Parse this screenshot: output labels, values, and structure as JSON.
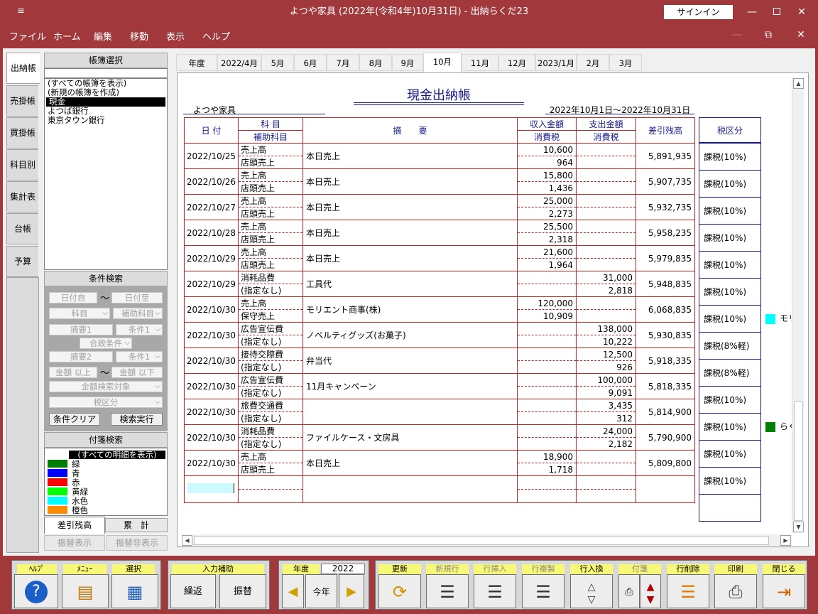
{
  "window": {
    "title": "よつや家具 (2022年(令和4年)10月31日)  -  出納らくだ23",
    "signin": "サインイン",
    "min": "—",
    "max": "☐",
    "close": "✕",
    "mdi_min": "—",
    "mdi_restore": "⧉",
    "mdi_close": "✕",
    "sysicon": "≡"
  },
  "menu": [
    "ファイル",
    "ホーム",
    "編集",
    "移動",
    "表示",
    "ヘルプ"
  ],
  "vtabs": [
    "出納帳",
    "売掛帳",
    "買掛帳",
    "科目別",
    "集計表",
    "台帳",
    "予算"
  ],
  "ledger": {
    "header": "帳簿選択",
    "items": [
      "(すべての帳簿を表示)",
      "(新規の帳簿を作成)",
      "現金",
      "よつば銀行",
      "東京タウン銀行"
    ],
    "selected": 2
  },
  "cond": {
    "header": "条件検索",
    "date_from": "日付自",
    "tilde": "〜",
    "date_to": "日付至",
    "account": "科目",
    "subaccount": "補助科目",
    "desc1": "摘要1",
    "cond1": "条件1",
    "combine": "合致条件",
    "desc2": "摘要2",
    "cond2": "条件1",
    "amt_from": "金額 以上",
    "amt_to": "金額 以下",
    "amt_target": "金額検索対象",
    "taxcat": "税区分",
    "clear": "条件クリア",
    "search": "検索実行"
  },
  "tags": {
    "header": "付箋検索",
    "all": "(すべての明細を表示)",
    "items": [
      {
        "name": "緑",
        "color": "#008000"
      },
      {
        "name": "青",
        "color": "#0000ff"
      },
      {
        "name": "赤",
        "color": "#ff0000"
      },
      {
        "name": "黄緑",
        "color": "#00ff00"
      },
      {
        "name": "水色",
        "color": "#00ffff"
      },
      {
        "name": "橙色",
        "color": "#ff8c00"
      }
    ]
  },
  "bottom_tabs": {
    "balance": "差引残高",
    "total": "累　計",
    "transfer_show": "振替表示",
    "transfer_hide": "振替非表示"
  },
  "month_tabs": [
    "年度",
    "2022/4月",
    "5月",
    "6月",
    "7月",
    "8月",
    "9月",
    "10月",
    "11月",
    "12月",
    "2023/1月",
    "2月",
    "3月"
  ],
  "active_month": "10月",
  "sheet": {
    "title": "現金出納帳",
    "company": "よつや家具",
    "period": "2022年10月1日〜2022年10月31日",
    "headers": {
      "date": "日 付",
      "account": "科 目",
      "subaccount": "補助科目",
      "desc": "摘　　要",
      "income": "収入金額",
      "income_tax": "消費税",
      "expense": "支出金額",
      "expense_tax": "消費税",
      "balance": "差引残高",
      "taxcat": "税区分"
    },
    "rows": [
      {
        "date": "2022/10/25",
        "account": "売上高",
        "sub": "店頭売上",
        "desc": "本日売上",
        "income": "10,600",
        "income_tax": "964",
        "expense": "",
        "expense_tax": "",
        "balance": "5,891,935",
        "tax": "課税(10%)"
      },
      {
        "date": "2022/10/26",
        "account": "売上高",
        "sub": "店頭売上",
        "desc": "本日売上",
        "income": "15,800",
        "income_tax": "1,436",
        "expense": "",
        "expense_tax": "",
        "balance": "5,907,735",
        "tax": "課税(10%)"
      },
      {
        "date": "2022/10/27",
        "account": "売上高",
        "sub": "店頭売上",
        "desc": "本日売上",
        "income": "25,000",
        "income_tax": "2,273",
        "expense": "",
        "expense_tax": "",
        "balance": "5,932,735",
        "tax": "課税(10%)"
      },
      {
        "date": "2022/10/28",
        "account": "売上高",
        "sub": "店頭売上",
        "desc": "本日売上",
        "income": "25,500",
        "income_tax": "2,318",
        "expense": "",
        "expense_tax": "",
        "balance": "5,958,235",
        "tax": "課税(10%)"
      },
      {
        "date": "2022/10/29",
        "account": "売上高",
        "sub": "店頭売上",
        "desc": "本日売上",
        "income": "21,600",
        "income_tax": "1,964",
        "expense": "",
        "expense_tax": "",
        "balance": "5,979,835",
        "tax": "課税(10%)"
      },
      {
        "date": "2022/10/29",
        "account": "消耗品費",
        "sub": "(指定なし)",
        "desc": "工具代",
        "income": "",
        "income_tax": "",
        "expense": "31,000",
        "expense_tax": "2,818",
        "balance": "5,948,835",
        "tax": "課税(10%)"
      },
      {
        "date": "2022/10/30",
        "account": "売上高",
        "sub": "保守売上",
        "desc": "モリエント商事(株)",
        "income": "120,000",
        "income_tax": "10,909",
        "expense": "",
        "expense_tax": "",
        "balance": "6,068,835",
        "tax": "課税(10%)"
      },
      {
        "date": "2022/10/30",
        "account": "広告宣伝費",
        "sub": "(指定なし)",
        "desc": "ノベルティグッズ(お菓子)",
        "income": "",
        "income_tax": "",
        "expense": "138,000",
        "expense_tax": "10,222",
        "balance": "5,930,835",
        "tax": "課税(8%軽)"
      },
      {
        "date": "2022/10/30",
        "account": "接待交際費",
        "sub": "(指定なし)",
        "desc": "弁当代",
        "income": "",
        "income_tax": "",
        "expense": "12,500",
        "expense_tax": "926",
        "balance": "5,918,335",
        "tax": "課税(8%軽)"
      },
      {
        "date": "2022/10/30",
        "account": "広告宣伝費",
        "sub": "(指定なし)",
        "desc": "11月キャンペーン",
        "income": "",
        "income_tax": "",
        "expense": "100,000",
        "expense_tax": "9,091",
        "balance": "5,818,335",
        "tax": "課税(10%)"
      },
      {
        "date": "2022/10/30",
        "account": "旅費交通費",
        "sub": "(指定なし)",
        "desc": "",
        "income": "",
        "income_tax": "",
        "expense": "3,435",
        "expense_tax": "312",
        "balance": "5,814,900",
        "tax": "課税(10%)"
      },
      {
        "date": "2022/10/30",
        "account": "消耗品費",
        "sub": "(指定なし)",
        "desc": "ファイルケース・文房具",
        "income": "",
        "income_tax": "",
        "expense": "24,000",
        "expense_tax": "2,182",
        "balance": "5,790,900",
        "tax": "課税(10%)"
      },
      {
        "date": "2022/10/30",
        "account": "売上高",
        "sub": "店頭売上",
        "desc": "本日売上",
        "income": "18,900",
        "income_tax": "1,718",
        "expense": "",
        "expense_tax": "",
        "balance": "5,809,800",
        "tax": "課税(10%)"
      }
    ],
    "side_tags": [
      {
        "row": 6,
        "text": "モリ",
        "color": "#00ffff"
      },
      {
        "row": 10,
        "text": "らく",
        "color": "#008000"
      }
    ]
  },
  "toolbar": {
    "help": "ﾍﾙﾌﾟ",
    "menu": "ﾒﾆｭｰ",
    "select": "選択",
    "input_assist": "入力補助",
    "repeat": "繰返",
    "transfer": "振替",
    "year": "年度",
    "year_value": "2022",
    "this_year": "今年",
    "refresh": "更新",
    "new_row": "新規行",
    "insert_row": "行挿入",
    "copy_row": "行複製",
    "swap_row": "行入換",
    "tag": "付箋",
    "delete_row": "行削除",
    "print": "印刷",
    "close": "閉じる"
  }
}
